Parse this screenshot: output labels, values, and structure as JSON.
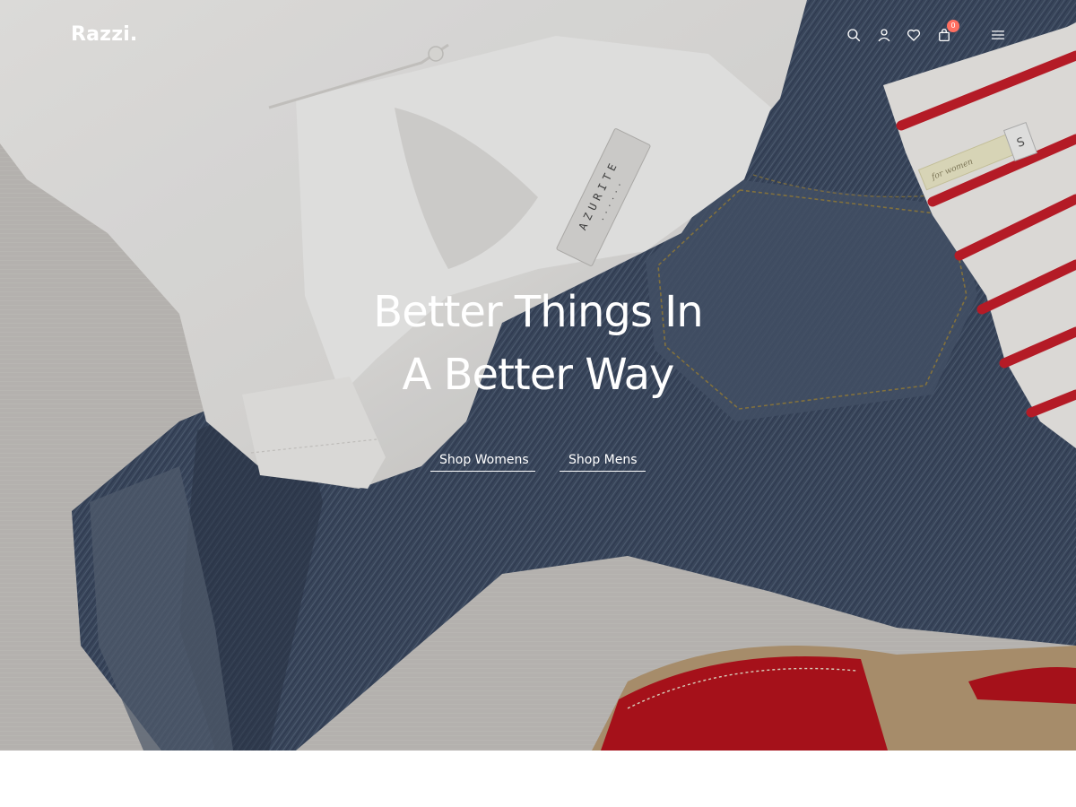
{
  "header": {
    "logo": "Razzi.",
    "icons": [
      "search-icon",
      "account-icon",
      "wishlist-icon",
      "cart-icon",
      "menu-icon"
    ],
    "cart_count": "0"
  },
  "hero": {
    "title_line1": "Better Things In",
    "title_line2": "A Better Way",
    "cta_women": "Shop Womens",
    "cta_men": "Shop Mens"
  },
  "colors": {
    "badge": "#ff6f61",
    "text": "#ffffff"
  }
}
